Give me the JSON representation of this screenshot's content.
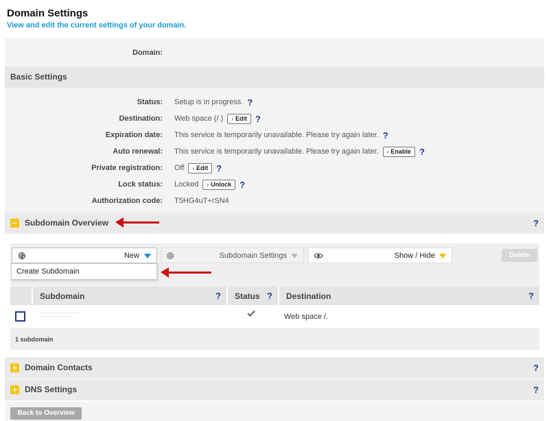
{
  "header": {
    "title": "Domain Settings",
    "subtitle": "View and edit the current settings of your domain."
  },
  "domain_row": {
    "label": "Domain:",
    "value": ""
  },
  "basic_settings": {
    "title": "Basic Settings",
    "rows": [
      {
        "label": "Status:",
        "value": "Setup is in progress.",
        "button": "",
        "help": "?"
      },
      {
        "label": "Destination:",
        "value": "Web space (/.)",
        "button": "Edit",
        "help": "?"
      },
      {
        "label": "Expiration date:",
        "value": "This service is temporarily unavailable. Please try again later.",
        "button": "",
        "help": "?"
      },
      {
        "label": "Auto renewal:",
        "value": "This service is temporarily unavailable. Please try again later.",
        "button": "Enable",
        "help": "?"
      },
      {
        "label": "Private registration:",
        "value": "Off",
        "button": "Edit",
        "help": "?"
      },
      {
        "label": "Lock status:",
        "value": "Locked",
        "button": "Unlock",
        "help": "?"
      },
      {
        "label": "Authorization code:",
        "value": "T5HG4uT+rSN4",
        "button": "",
        "help": ""
      }
    ]
  },
  "subdomain_overview": {
    "title": "Subdomain Overview",
    "help": "?",
    "toolbar": {
      "new_label": "New",
      "settings_label": "Subdomain Settings",
      "show_hide_label": "Show / Hide",
      "delete_label": "Delete"
    },
    "new_menu": {
      "create_label": "Create Subdomain"
    },
    "table": {
      "columns": [
        {
          "label": "Subdomain",
          "help": "?"
        },
        {
          "label": "Status",
          "help": "?"
        },
        {
          "label": "Destination",
          "help": "?"
        }
      ],
      "rows": [
        {
          "subdomain": "",
          "status_icon": "checkmark-icon",
          "destination": "Web space /."
        }
      ],
      "footer": "1 subdomain"
    }
  },
  "domain_contacts": {
    "title": "Domain Contacts",
    "help": "?"
  },
  "dns_settings": {
    "title": "DNS Settings",
    "help": "?"
  },
  "footer": {
    "back_label": "Back to Overview"
  },
  "colors": {
    "accent_blue": "#1a9ad6",
    "help_navy": "#1e3c8c",
    "toggle_yellow": "#f5c518",
    "annotation_red": "#cc1111",
    "dropdown_blue": "#1a8ed6",
    "dropdown_yellow": "#e8c000"
  }
}
